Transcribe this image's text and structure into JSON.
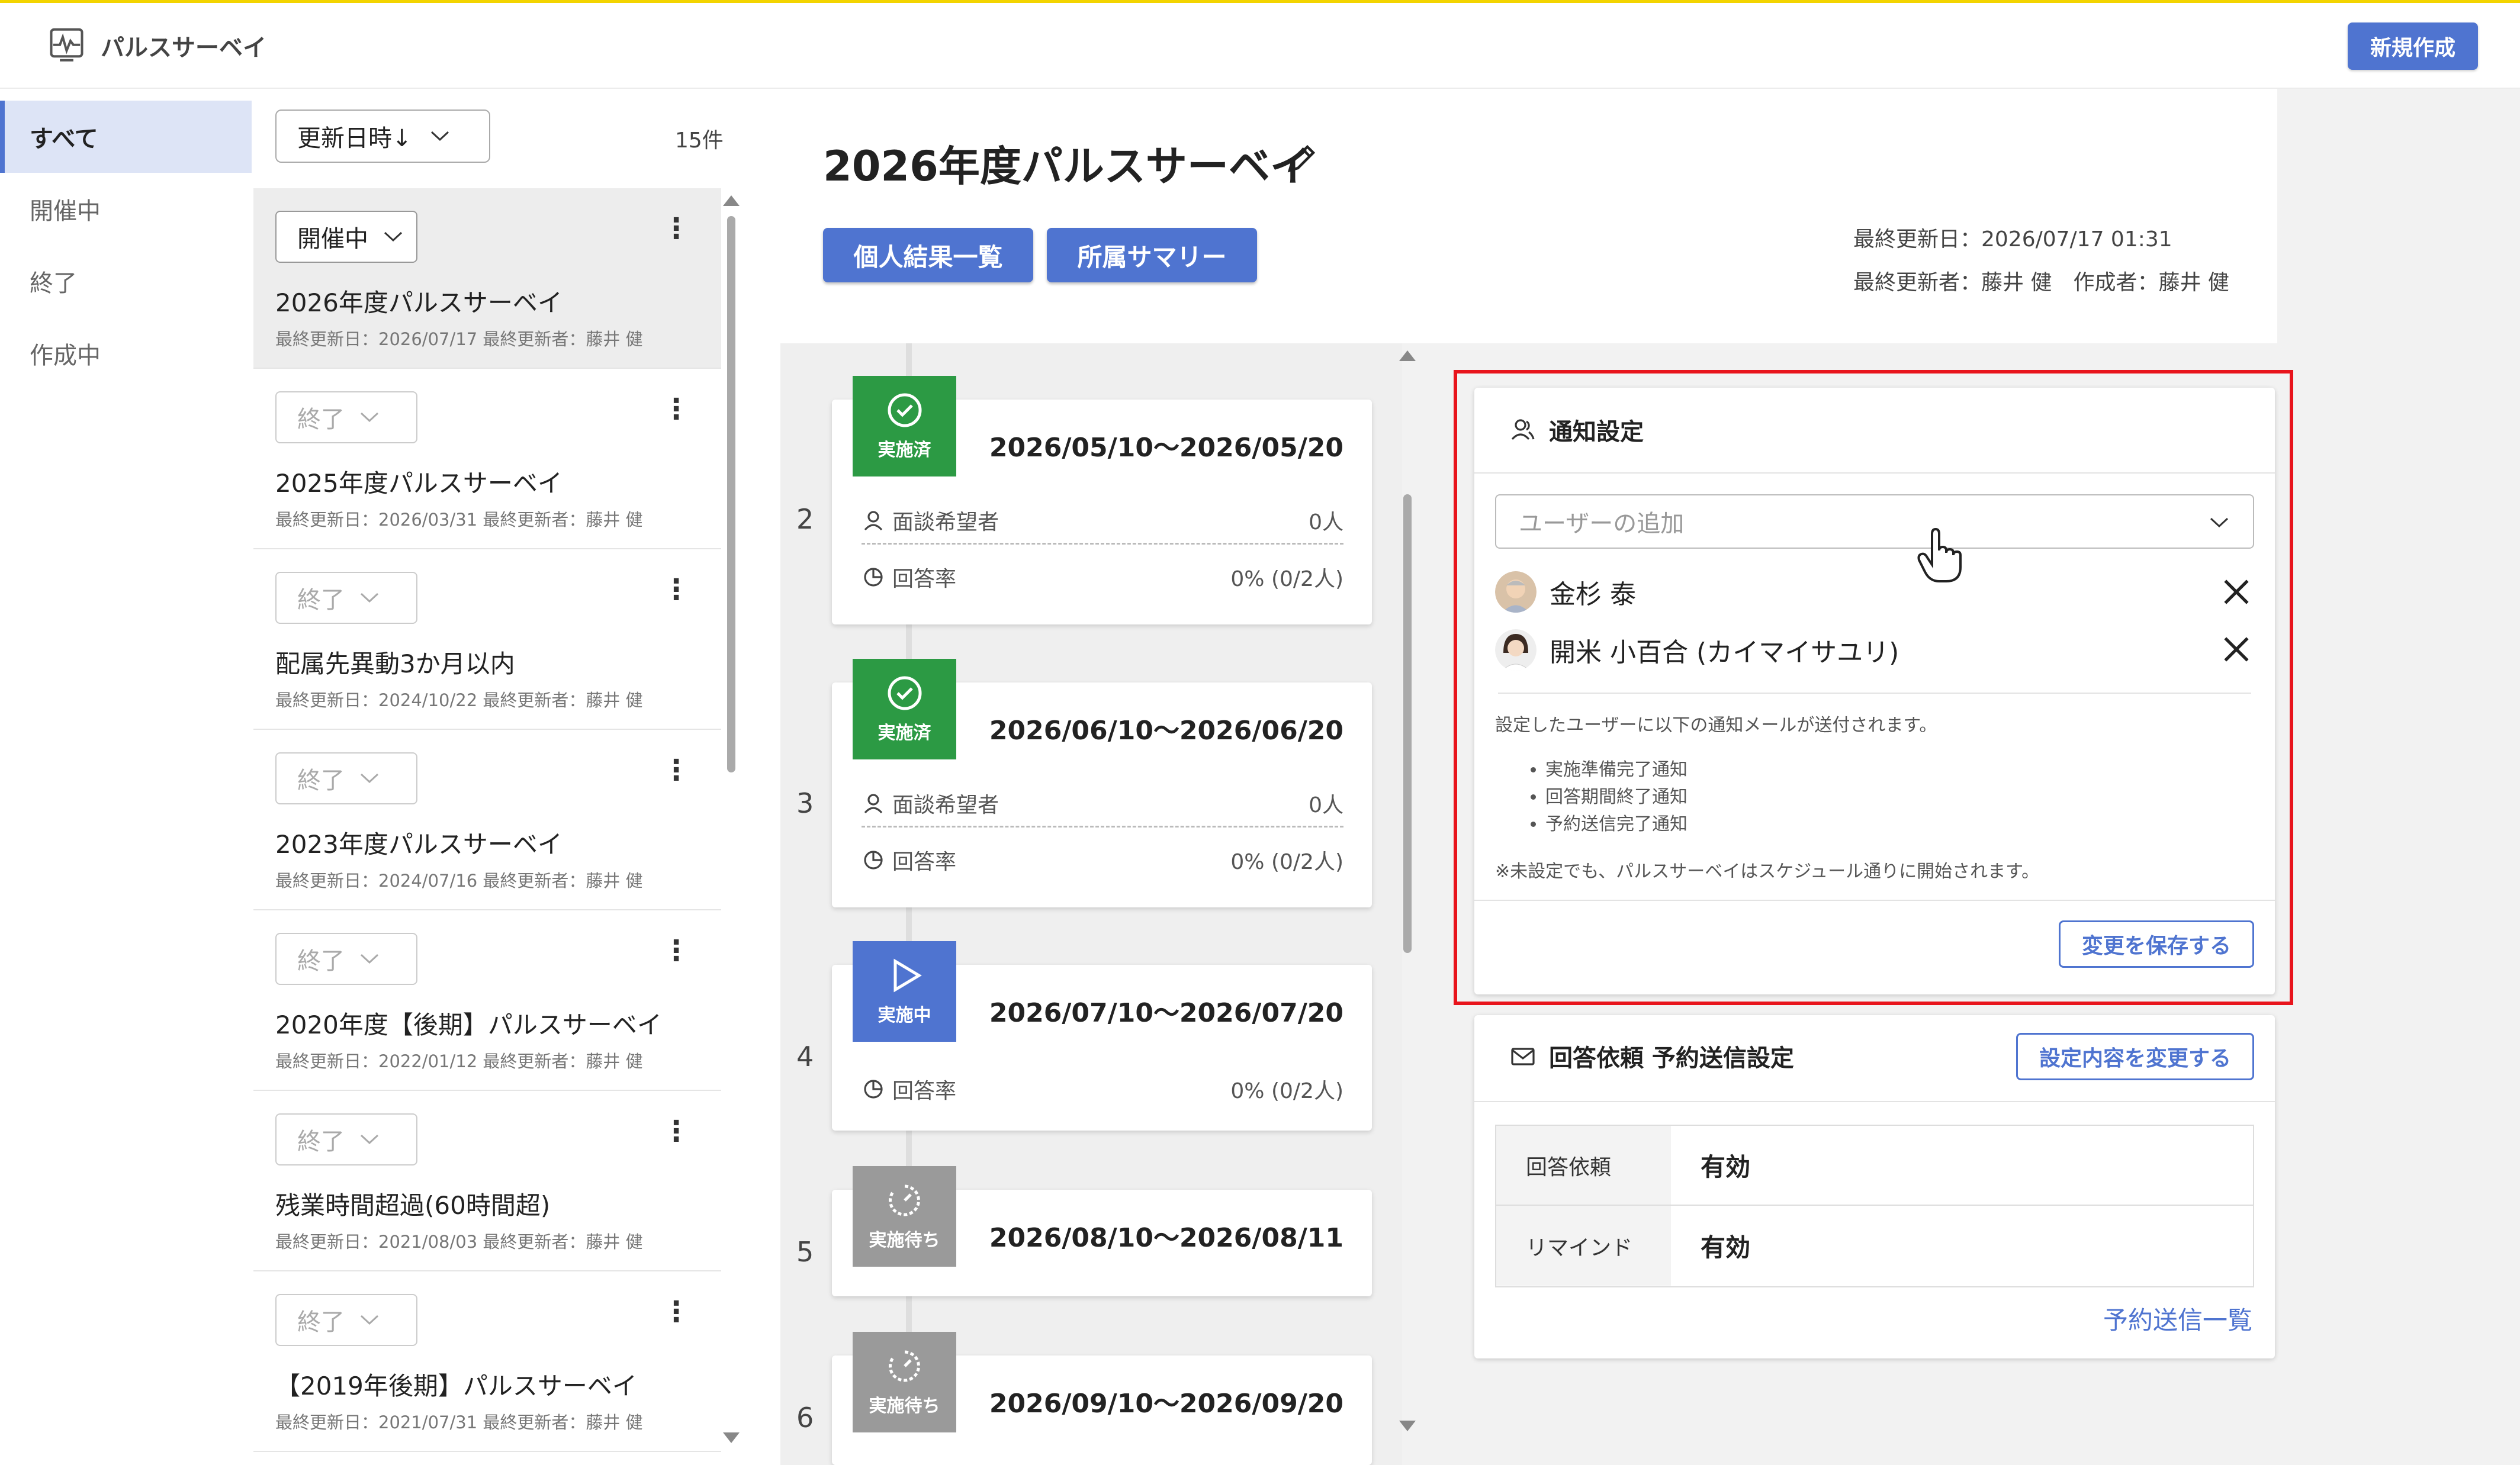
{
  "app": {
    "title": "パルスサーベイ",
    "new_button": "新規作成"
  },
  "sidebar": {
    "items": [
      {
        "label": "すべて"
      },
      {
        "label": "開催中"
      },
      {
        "label": "終了"
      },
      {
        "label": "作成中"
      }
    ]
  },
  "list": {
    "sort_label": "更新日時↓",
    "count": "15件",
    "items": [
      {
        "status": "開催中",
        "title": "2026年度パルスサーベイ",
        "meta": "最終更新日：2026/07/17  最終更新者：藤井 健"
      },
      {
        "status": "終了",
        "title": "2025年度パルスサーベイ",
        "meta": "最終更新日：2026/03/31  最終更新者：藤井 健"
      },
      {
        "status": "終了",
        "title": "配属先異動3か月以内",
        "meta": "最終更新日：2024/10/22  最終更新者：藤井 健"
      },
      {
        "status": "終了",
        "title": "2023年度パルスサーベイ",
        "meta": "最終更新日：2024/07/16  最終更新者：藤井 健"
      },
      {
        "status": "終了",
        "title": "2020年度【後期】パルスサーベイ",
        "meta": "最終更新日：2022/01/12  最終更新者：藤井 健"
      },
      {
        "status": "終了",
        "title": "残業時間超過(60時間超)",
        "meta": "最終更新日：2021/08/03  最終更新者：藤井 健"
      },
      {
        "status": "終了",
        "title": "【2019年後期】パルスサーベイ",
        "meta": "最終更新日：2021/07/31  最終更新者：藤井 健"
      }
    ]
  },
  "detail": {
    "title": "2026年度パルスサーベイ",
    "tabs": [
      "個人結果一覧",
      "所属サマリー"
    ],
    "updated": "最終更新日：2026/07/17 01:31",
    "updater_creator": "最終更新者：藤井 健　作成者：藤井 健"
  },
  "timeline": [
    {
      "num": "2",
      "badge": "実施済",
      "date": "2026/05/10〜2026/05/20",
      "interview_label": "面談希望者",
      "interview_value": "0人",
      "rate_label": "回答率",
      "rate_value": "0% (0/2人)"
    },
    {
      "num": "3",
      "badge": "実施済",
      "date": "2026/06/10〜2026/06/20",
      "interview_label": "面談希望者",
      "interview_value": "0人",
      "rate_label": "回答率",
      "rate_value": "0% (0/2人)"
    },
    {
      "num": "4",
      "badge": "実施中",
      "date": "2026/07/10〜2026/07/20",
      "rate_label": "回答率",
      "rate_value": "0% (0/2人)"
    },
    {
      "num": "5",
      "badge": "実施待ち",
      "date": "2026/08/10〜2026/08/11"
    },
    {
      "num": "6",
      "badge": "実施待ち",
      "date": "2026/09/10〜2026/09/20"
    }
  ],
  "notification": {
    "title": "通知設定",
    "select_placeholder": "ユーザーの追加",
    "users": [
      "金杉 泰",
      "開米 小百合 (カイマイサユリ)"
    ],
    "desc": "設定したユーザーに以下の通知メールが送付されます。",
    "bullets": [
      "実施準備完了通知",
      "回答期間終了通知",
      "予約送信完了通知"
    ],
    "note": "※未設定でも、パルスサーベイはスケジュール通りに開始されます。",
    "save_button": "変更を保存する"
  },
  "schedule": {
    "title": "回答依頼 予約送信設定",
    "change_button": "設定内容を変更する",
    "rows": [
      {
        "label": "回答依頼",
        "value": "有効"
      },
      {
        "label": "リマインド",
        "value": "有効"
      }
    ],
    "link": "予約送信一覧"
  },
  "colors": {
    "accent": "#4f74d0",
    "done": "#2c9a44",
    "wait": "#9a9a9a",
    "highlight": "#e8141c",
    "topline": "#f3d400"
  }
}
